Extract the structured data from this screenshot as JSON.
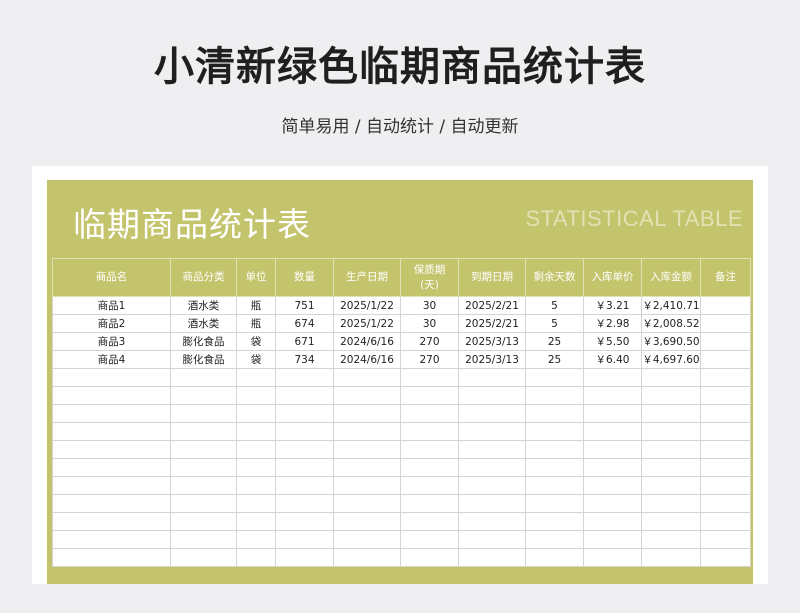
{
  "page": {
    "title": "小清新绿色临期商品统计表",
    "subtitle": "简单易用 / 自动统计 / 自动更新"
  },
  "sheet": {
    "title": "临期商品统计表",
    "title_en": "STATISTICAL TABLE",
    "headers": [
      "商品名",
      "商品分类",
      "单位",
      "数量",
      "生产日期",
      "保质期\n(天)",
      "到期日期",
      "剩余天数",
      "入库单价",
      "入库金额",
      "备注"
    ],
    "rows": [
      [
        "商品1",
        "酒水类",
        "瓶",
        "751",
        "2025/1/22",
        "30",
        "2025/2/21",
        "5",
        "￥3.21",
        "￥2,410.71",
        ""
      ],
      [
        "商品2",
        "酒水类",
        "瓶",
        "674",
        "2025/1/22",
        "30",
        "2025/2/21",
        "5",
        "￥2.98",
        "￥2,008.52",
        ""
      ],
      [
        "商品3",
        "膨化食品",
        "袋",
        "671",
        "2024/6/16",
        "270",
        "2025/3/13",
        "25",
        "￥5.50",
        "￥3,690.50",
        ""
      ],
      [
        "商品4",
        "膨化食品",
        "袋",
        "734",
        "2024/6/16",
        "270",
        "2025/3/13",
        "25",
        "￥6.40",
        "￥4,697.60",
        ""
      ]
    ]
  },
  "colors": {
    "accent": "#c4c46d",
    "background": "#efeff1"
  }
}
